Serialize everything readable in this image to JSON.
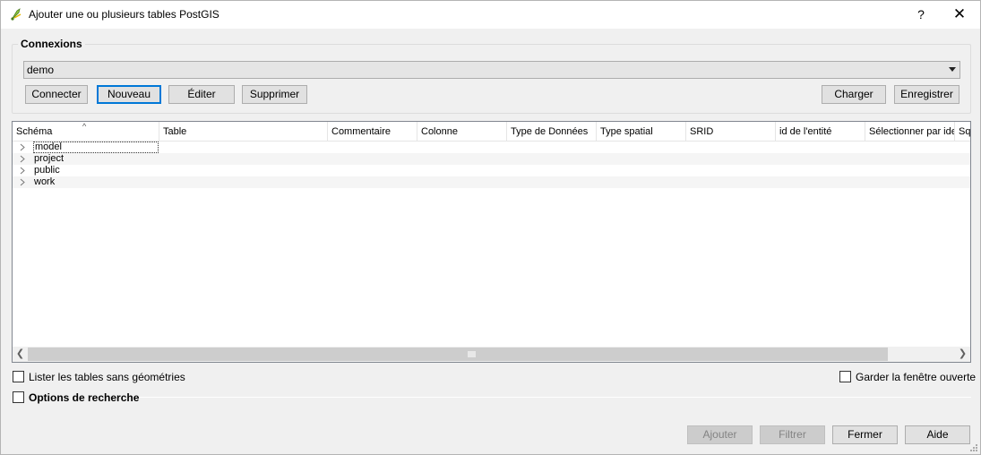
{
  "window": {
    "title": "Ajouter une ou plusieurs tables PostGIS",
    "help_glyph": "?",
    "close_glyph": "✕",
    "icon": "qgis-icon"
  },
  "connections": {
    "group_title": "Connexions",
    "selected": "demo",
    "buttons": {
      "connect": "Connecter",
      "new": "Nouveau",
      "edit": "Éditer",
      "delete": "Supprimer",
      "load": "Charger",
      "save": "Enregistrer"
    }
  },
  "table": {
    "columns": [
      "Schéma",
      "Table",
      "Commentaire",
      "Colonne",
      "Type de Données",
      "Type spatial",
      "SRID",
      "id de l'entité",
      "Sélectionner par ide",
      "Sql"
    ],
    "rows": [
      {
        "label": "model",
        "selected": true
      },
      {
        "label": "project",
        "selected": false
      },
      {
        "label": "public",
        "selected": false
      },
      {
        "label": "work",
        "selected": false
      }
    ]
  },
  "options": {
    "list_no_geom": "Lister les tables sans géométries",
    "keep_open": "Garder la fenêtre ouverte",
    "search_options": "Options de recherche"
  },
  "footer": {
    "add": "Ajouter",
    "filter": "Filtrer",
    "close": "Fermer",
    "help": "Aide"
  },
  "colors": {
    "focus": "#0078d7",
    "window_bg": "#f0f0f0"
  }
}
